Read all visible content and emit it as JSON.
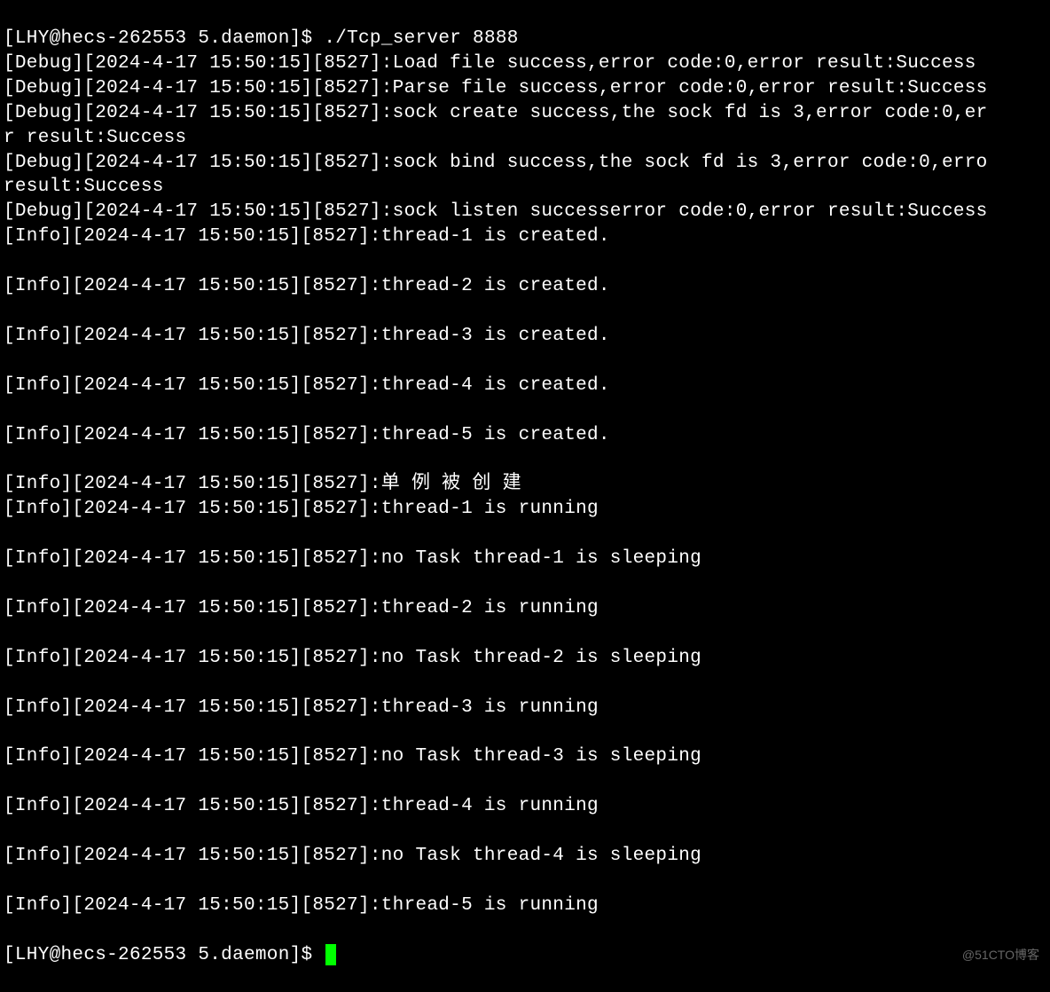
{
  "prompt1": {
    "user": "LHY",
    "host": "hecs-262553",
    "dir": "5.daemon",
    "symbol": "$",
    "command": "./Tcp_server 8888"
  },
  "lines": [
    "[Debug][2024-4-17 15:50:15][8527]:Load file success,error code:0,error result:Success",
    "[Debug][2024-4-17 15:50:15][8527]:Parse file success,error code:0,error result:Success",
    "[Debug][2024-4-17 15:50:15][8527]:sock create success,the sock fd is 3,error code:0,er",
    "r result:Success",
    "[Debug][2024-4-17 15:50:15][8527]:sock bind success,the sock fd is 3,error code:0,erro",
    "result:Success",
    "[Debug][2024-4-17 15:50:15][8527]:sock listen successerror code:0,error result:Success",
    "[Info][2024-4-17 15:50:15][8527]:thread-1 is created.",
    "",
    "[Info][2024-4-17 15:50:15][8527]:thread-2 is created.",
    "",
    "[Info][2024-4-17 15:50:15][8527]:thread-3 is created.",
    "",
    "[Info][2024-4-17 15:50:15][8527]:thread-4 is created.",
    "",
    "[Info][2024-4-17 15:50:15][8527]:thread-5 is created.",
    "",
    "[Info][2024-4-17 15:50:15][8527]:单 例 被 创 建",
    "[Info][2024-4-17 15:50:15][8527]:thread-1 is running",
    "",
    "[Info][2024-4-17 15:50:15][8527]:no Task thread-1 is sleeping",
    "",
    "[Info][2024-4-17 15:50:15][8527]:thread-2 is running",
    "",
    "[Info][2024-4-17 15:50:15][8527]:no Task thread-2 is sleeping",
    "",
    "[Info][2024-4-17 15:50:15][8527]:thread-3 is running",
    "",
    "[Info][2024-4-17 15:50:15][8527]:no Task thread-3 is sleeping",
    "",
    "[Info][2024-4-17 15:50:15][8527]:thread-4 is running",
    "",
    "[Info][2024-4-17 15:50:15][8527]:no Task thread-4 is sleeping",
    "",
    "[Info][2024-4-17 15:50:15][8527]:thread-5 is running",
    ""
  ],
  "prompt2": {
    "user": "LHY",
    "host": "hecs-262553",
    "dir": "5.daemon",
    "symbol": "$"
  },
  "watermark": "@51CTO博客"
}
